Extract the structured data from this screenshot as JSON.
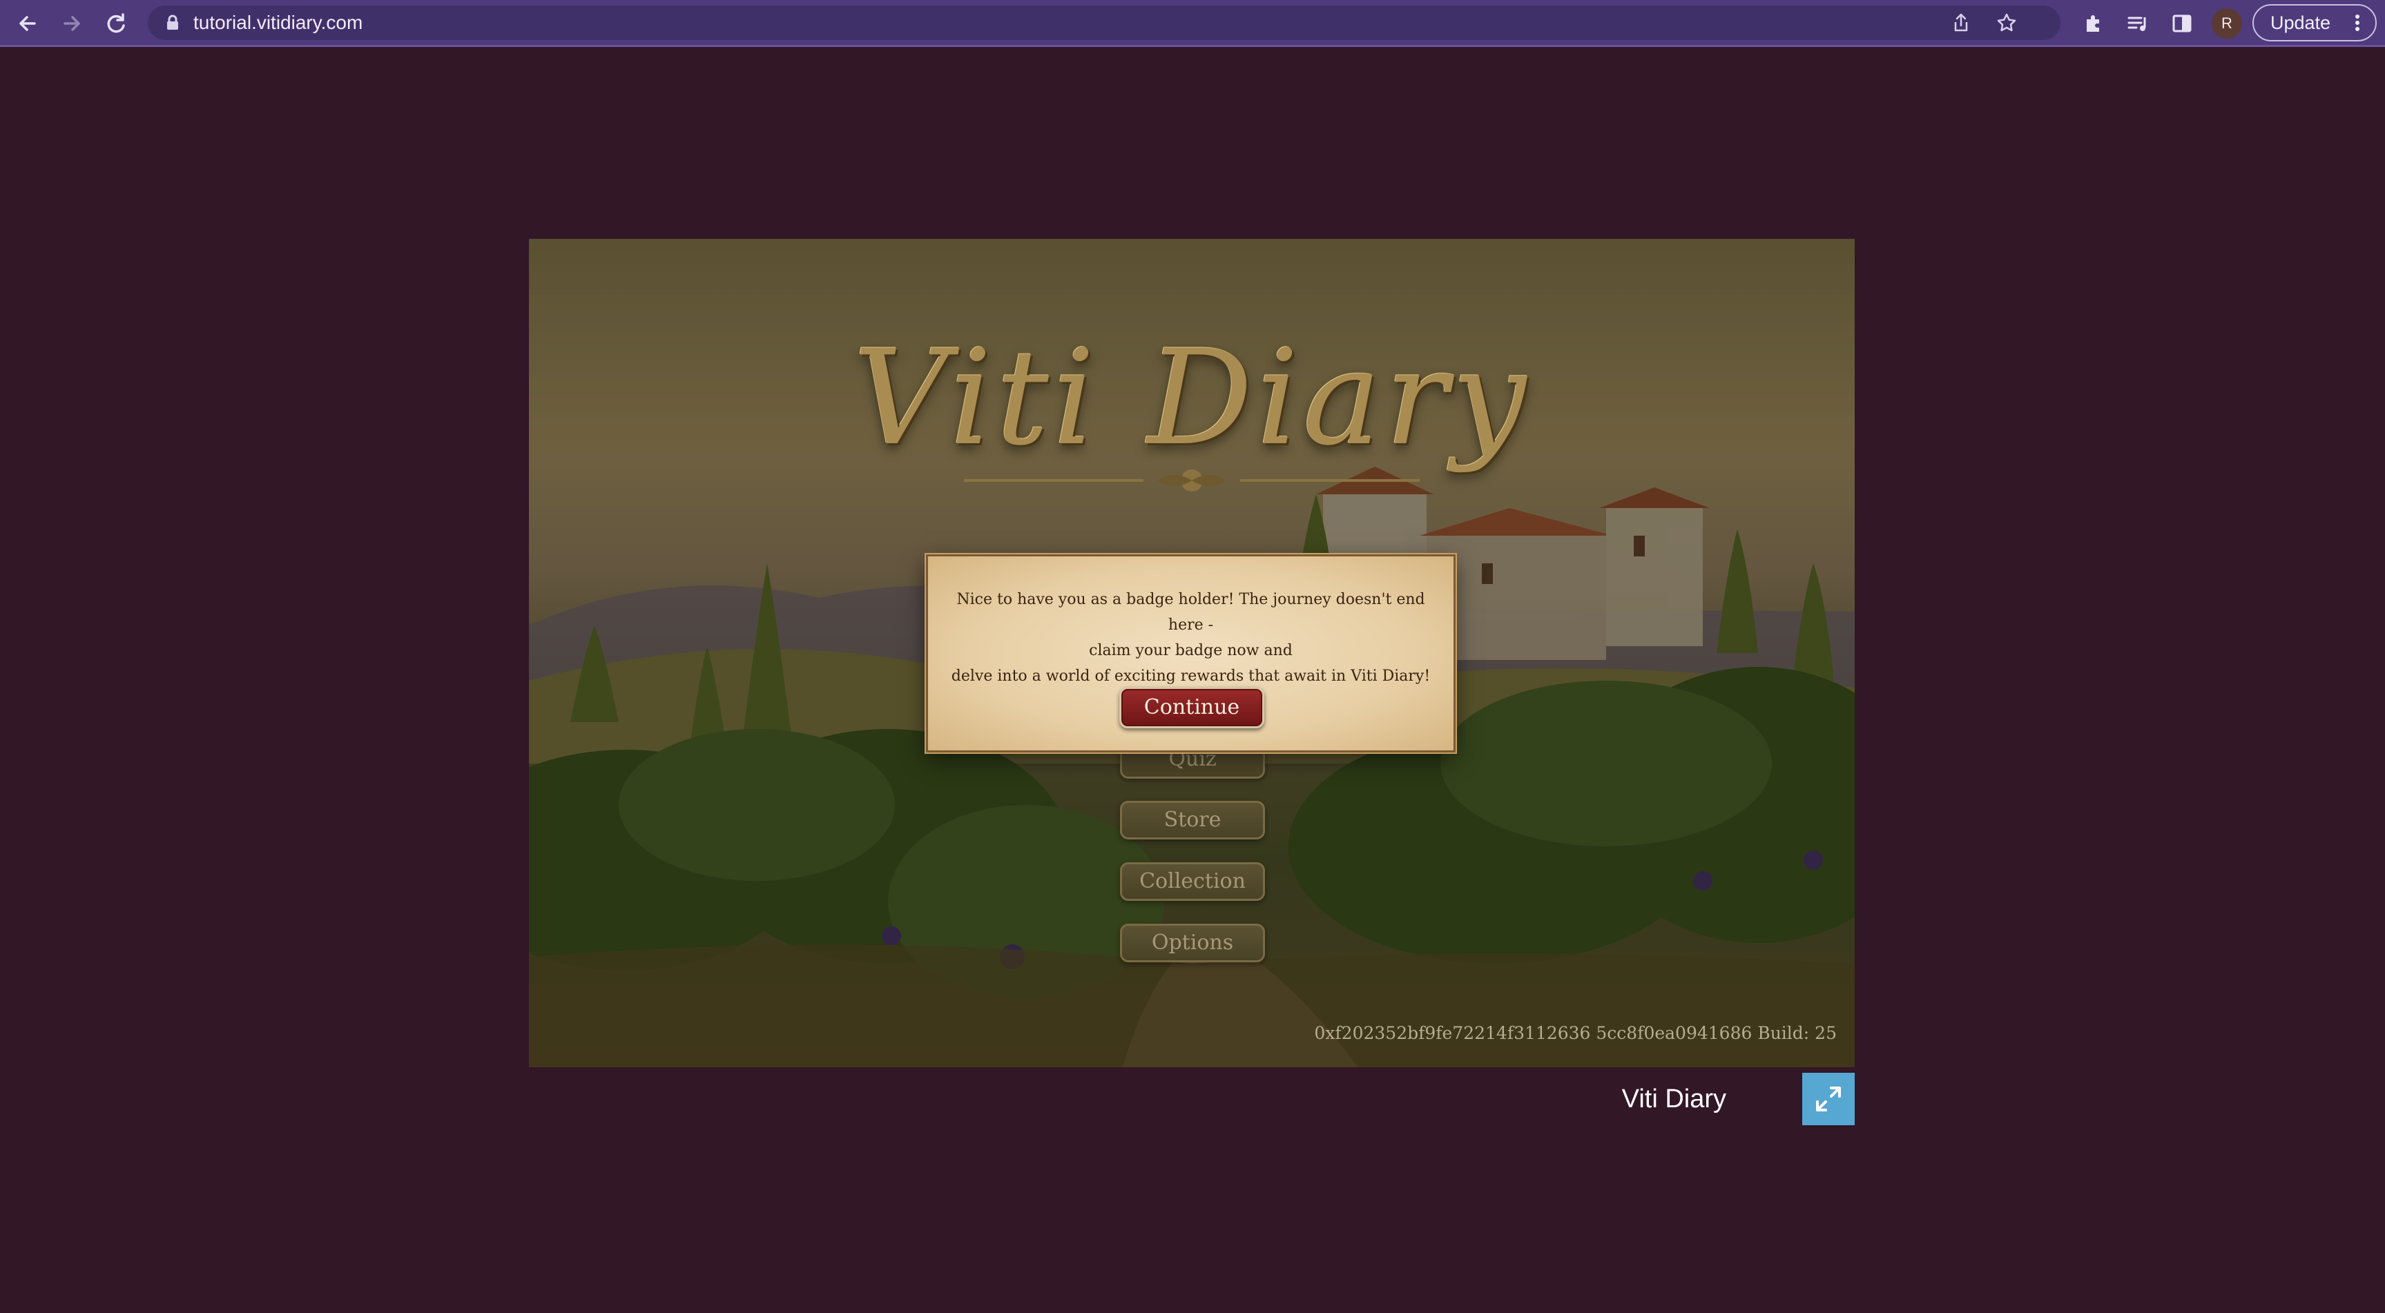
{
  "browser": {
    "url": "tutorial.vitidiary.com",
    "profile_initial": "R",
    "update_label": "Update",
    "toolbar_colors": {
      "frame": "#4f3a7c",
      "omnibox": "#40306a"
    },
    "icons": [
      "back-icon",
      "forward-icon",
      "reload-icon",
      "lock-icon",
      "share-icon",
      "star-icon",
      "extensions-icon",
      "media-queue-icon",
      "side-panel-icon",
      "menu-icon"
    ]
  },
  "game": {
    "logo_word_1": "Viti",
    "logo_word_2": "Diary",
    "menu": [
      "Quiz",
      "Store",
      "Collection",
      "Options"
    ],
    "build_info": "0xf202352bf9fe72214f3112636 5cc8f0ea0941686 Build: 25",
    "dialog": {
      "line_1": "Nice to have you as a badge holder! The journey doesn't end here -",
      "line_2": "claim your badge now and",
      "line_3": "delve into a world of exciting rewards that await in Viti Diary!",
      "continue_label": "Continue"
    }
  },
  "footer": {
    "title": "Viti Diary",
    "fullscreen_icon": "expand-icon",
    "accent": "#56a8d3"
  },
  "colors": {
    "page_bg": "#321727",
    "dialog_button": "#8a2020"
  }
}
